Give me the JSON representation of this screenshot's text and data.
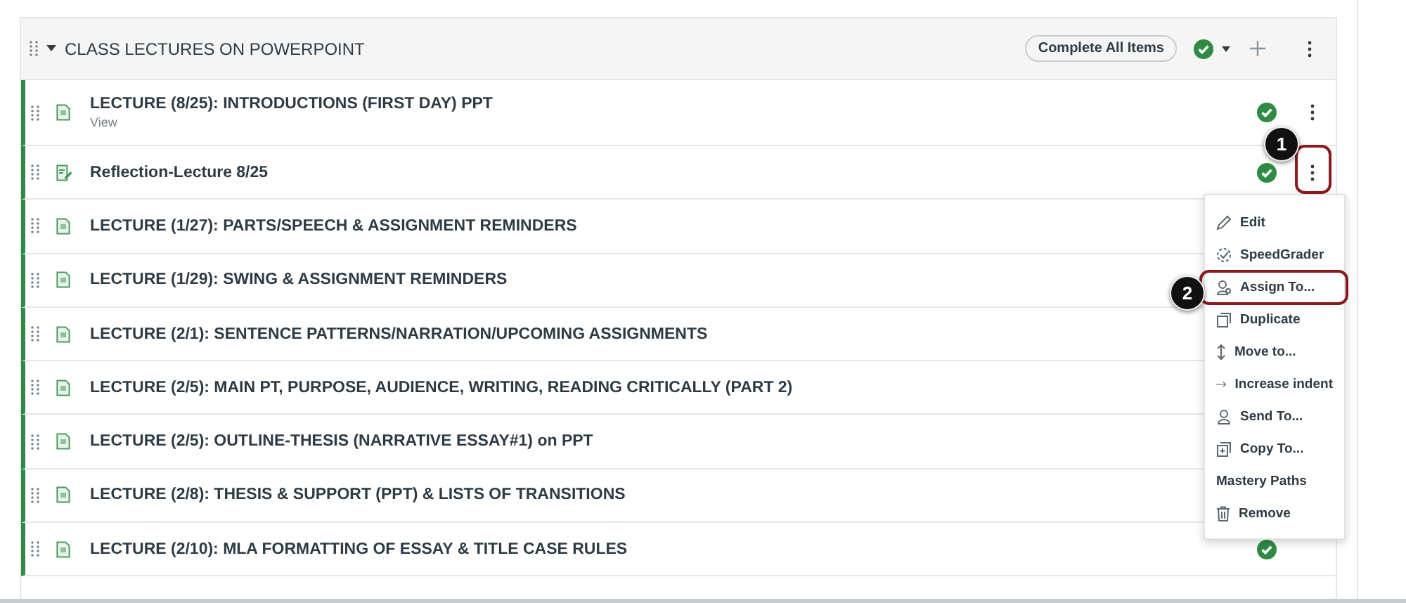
{
  "module": {
    "title": "CLASS LECTURES ON POWERPOINT",
    "expanded": true,
    "complete_button": "Complete All Items",
    "completed": true
  },
  "items": [
    {
      "kind": "page",
      "title": "LECTURE (8/25): INTRODUCTIONS (FIRST DAY) PPT",
      "subtitle": "View",
      "published": true,
      "completed": true,
      "menu_button": true
    },
    {
      "kind": "assignment",
      "title": "Reflection-Lecture 8/25",
      "published": true,
      "completed": true,
      "menu_button": true,
      "highlighted": true
    },
    {
      "kind": "page",
      "title": "LECTURE (1/27): PARTS/SPEECH & ASSIGNMENT REMINDERS",
      "published": true
    },
    {
      "kind": "page",
      "title": "LECTURE (1/29): SWING & ASSIGNMENT REMINDERS",
      "published": true
    },
    {
      "kind": "page",
      "title": "LECTURE (2/1): SENTENCE PATTERNS/NARRATION/UPCOMING ASSIGNMENTS",
      "published": true
    },
    {
      "kind": "page",
      "title": "LECTURE (2/5): MAIN PT, PURPOSE, AUDIENCE, WRITING, READING CRITICALLY (PART 2)",
      "published": true
    },
    {
      "kind": "page",
      "title": "LECTURE (2/5): OUTLINE-THESIS (NARRATIVE ESSAY#1) on PPT",
      "published": true
    },
    {
      "kind": "page",
      "title": "LECTURE (2/8): THESIS & SUPPORT (PPT) & LISTS OF TRANSITIONS",
      "published": true
    },
    {
      "kind": "page",
      "title": "LECTURE (2/10): MLA FORMATTING OF ESSAY & TITLE CASE RULES",
      "published": true,
      "completed": true
    }
  ],
  "menu": {
    "items": [
      {
        "label": "Edit",
        "highlighted": false
      },
      {
        "label": "SpeedGrader",
        "highlighted": false
      },
      {
        "label": "Assign To...",
        "highlighted": true
      },
      {
        "label": "Duplicate",
        "highlighted": false
      },
      {
        "label": "Move to...",
        "highlighted": false
      },
      {
        "label": "Increase indent",
        "highlighted": false
      },
      {
        "label": "Send To...",
        "highlighted": false
      },
      {
        "label": "Copy To...",
        "highlighted": false
      },
      {
        "label": "Mastery Paths",
        "highlighted": false
      },
      {
        "label": "Remove",
        "highlighted": false
      }
    ]
  },
  "callouts": [
    {
      "label": "1"
    },
    {
      "label": "2"
    }
  ]
}
